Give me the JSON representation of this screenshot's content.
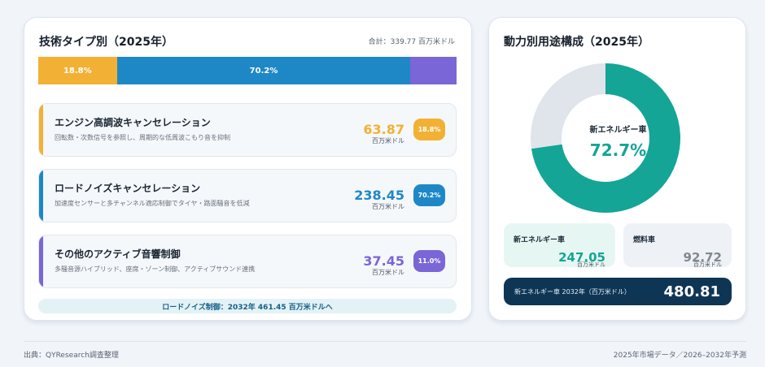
{
  "colors": {
    "engine": "#f2b134",
    "road": "#1e88c7",
    "other": "#7a66d6",
    "ev": "#14a596",
    "fuel": "#dfe5ea",
    "fuel_text": "#808890"
  },
  "left": {
    "title": "技術タイプ別（2025年）",
    "total": "合計：339.77 百万米ドル",
    "projection": "ロードノイズ制御：2032年 461.45 百万米ドルへ",
    "rows": [
      {
        "name": "エンジン高調波キャンセレーション",
        "desc": "回転数・次数信号を参照し、周期的な低周波こもり音を抑制",
        "value": "63.87",
        "unit": "百万米ドル",
        "share": "18.8%",
        "color_key": "engine"
      },
      {
        "name": "ロードノイズキャンセレーション",
        "desc": "加速度センサーと多チャンネル適応制御でタイヤ・路面騒音を低減",
        "value": "238.45",
        "unit": "百万米ドル",
        "share": "70.2%",
        "color_key": "road"
      },
      {
        "name": "その他のアクティブ音響制御",
        "desc": "多騒音源ハイブリッド、座席・ゾーン制御、アクティブサウンド連携",
        "value": "37.45",
        "unit": "百万米ドル",
        "share": "11.0%",
        "color_key": "other"
      }
    ]
  },
  "right": {
    "title": "動力別用途構成（2025年）",
    "center_label": "新エネルギー車",
    "center_value": "72.7%",
    "ev_label": "新エネルギー車",
    "ev_value": "247.05",
    "ev_unit": "百万米ドル",
    "fuel_label": "燃料車",
    "fuel_value": "92.72",
    "fuel_unit": "百万米ドル",
    "ev2032_label": "新エネルギー車 2032年（百万米ドル）",
    "ev2032_value": "480.81"
  },
  "footer": {
    "source": "出典：QYResearch調査整理",
    "note": "2025年市場データ／2026–2032年予測"
  },
  "chart_data": [
    {
      "type": "bar",
      "title": "技術タイプ別（2025年）",
      "categories": [
        "エンジン高調波キャンセレーション",
        "ロードノイズキャンセレーション",
        "その他のアクティブ音響制御"
      ],
      "values": [
        63.87,
        238.45,
        37.45
      ],
      "shares": [
        18.8,
        70.2,
        11.0
      ],
      "segment_labels": [
        "18.8%",
        "70.2%",
        ""
      ],
      "total": 339.77
    },
    {
      "type": "pie",
      "title": "動力別用途構成（2025年）",
      "categories": [
        "新エネルギー車",
        "燃料車"
      ],
      "values": [
        247.05,
        92.72
      ],
      "shares": [
        72.7,
        27.3
      ]
    }
  ]
}
